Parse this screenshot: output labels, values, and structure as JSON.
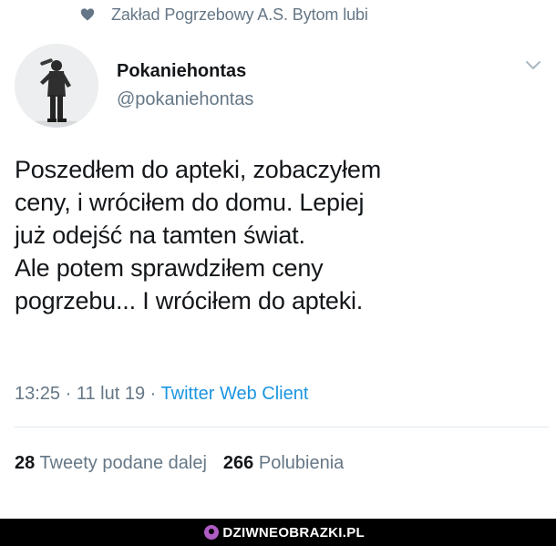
{
  "social_context": {
    "icon": "heart-icon",
    "text": "Zakład Pogrzebowy A.S. Bytom lubi"
  },
  "author": {
    "display_name": "Pokaniehontas",
    "handle": "@pokaniehontas"
  },
  "tweet": {
    "lines": [
      "Poszedłem do apteki, zobaczyłem",
      "ceny, i wróciłem do domu. Lepiej",
      "już odejść na tamten świat.",
      "Ale potem sprawdziłem ceny",
      "pogrzebu... I wróciłem do apteki."
    ],
    "time": "13:25",
    "separator": " · ",
    "date": "11 lut 19",
    "source": "Twitter Web Client"
  },
  "stats": {
    "retweets_count": "28",
    "retweets_label": " Tweety podane dalej",
    "likes_count": "266",
    "likes_label": " Polubienia"
  },
  "watermark": {
    "text": "DZIWNEOBRAZKI.PL"
  },
  "colors": {
    "text_primary": "#14171a",
    "text_secondary": "#657786",
    "link": "#1b95e0",
    "divider": "#e1e8ed"
  }
}
